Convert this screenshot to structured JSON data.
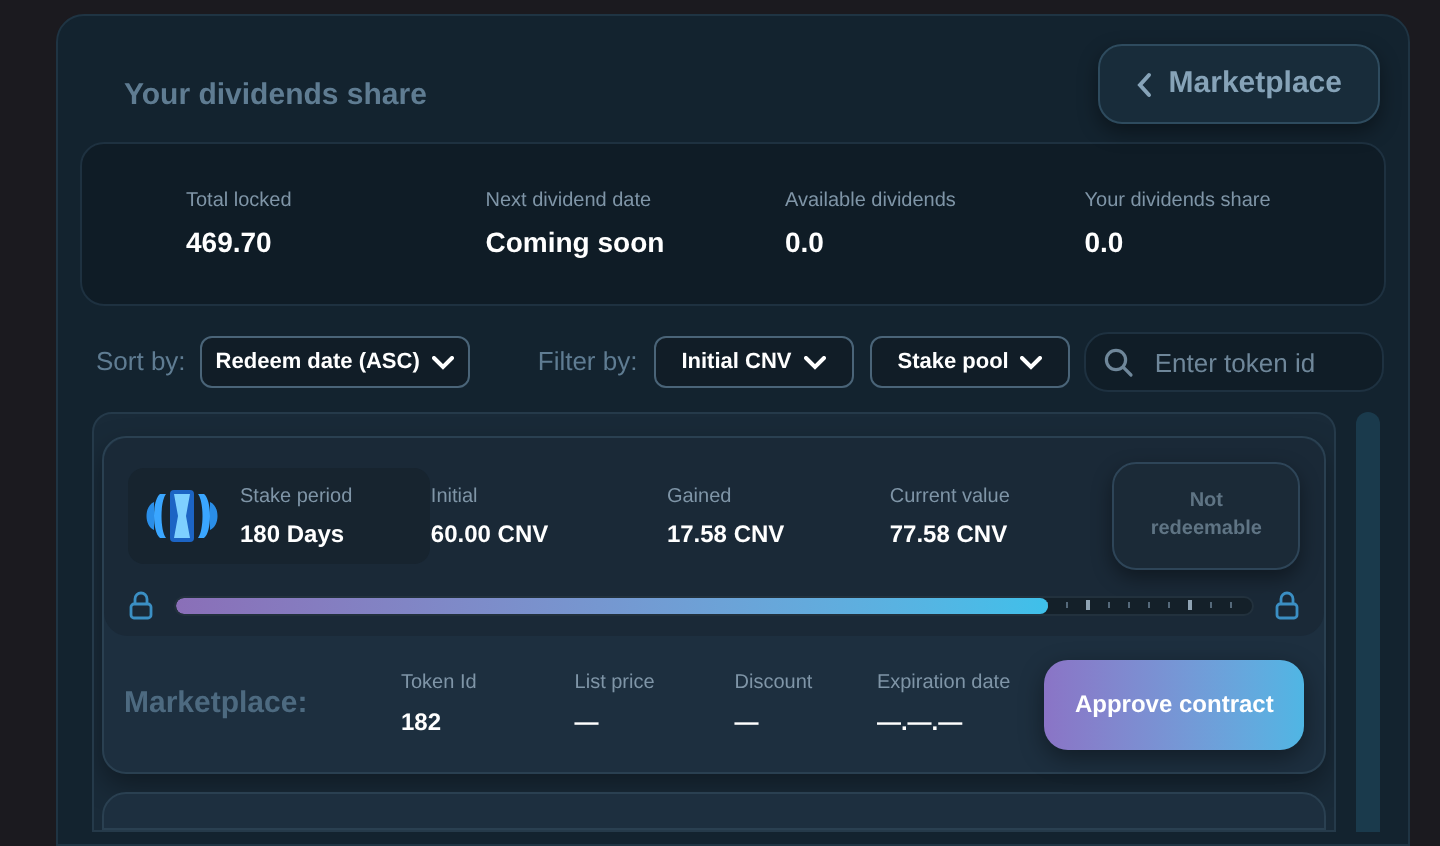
{
  "header": {
    "title": "Your dividends share",
    "back_button": "Marketplace"
  },
  "stats": [
    {
      "label": "Total locked",
      "value": "469.70"
    },
    {
      "label": "Next dividend date",
      "value": "Coming soon"
    },
    {
      "label": "Available dividends",
      "value": "0.0"
    },
    {
      "label": "Your dividends share",
      "value": "0.0"
    }
  ],
  "controls": {
    "sort_label": "Sort by:",
    "sort": "Redeem date (ASC)",
    "filter_label": "Filter by:",
    "filters": [
      "Initial CNV",
      "Stake pool"
    ],
    "search": {
      "placeholder": "Enter token id"
    }
  },
  "stakes": [
    {
      "fields": [
        {
          "label": "Stake period",
          "value": "180 Days"
        },
        {
          "label": "Initial",
          "value": "60.00 CNV"
        },
        {
          "label": "Gained",
          "value": "17.58 CNV"
        },
        {
          "label": "Current value",
          "value": "77.58 CNV"
        }
      ],
      "status_button": {
        "label": "Not redeemable",
        "disabled": true
      },
      "level": 0.81,
      "marketplace": {
        "label": "Marketplace:",
        "fields": [
          {
            "label": "Token Id",
            "value": "182"
          },
          {
            "label": "List price",
            "value": "—"
          },
          {
            "label": "Discount",
            "value": "—"
          },
          {
            "label": "Expiration date",
            "value": "—.—.—"
          }
        ],
        "button": "Approve contract"
      }
    }
  ]
}
